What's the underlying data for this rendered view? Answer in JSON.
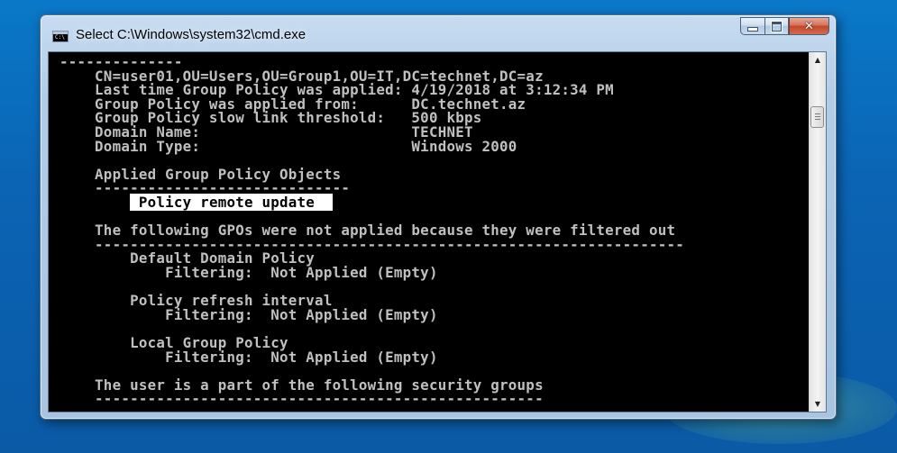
{
  "window": {
    "title": "Select C:\\Windows\\system32\\cmd.exe",
    "icon_label": "C:\\",
    "controls": {
      "minimize": "minimize-icon",
      "maximize": "maximize-icon",
      "close": "✕"
    }
  },
  "console": {
    "lines": [
      {
        "text": "--------------"
      },
      {
        "text": "    CN=user01,OU=Users,OU=Group1,OU=IT,DC=technet,DC=az"
      },
      {
        "text": "    Last time Group Policy was applied: 4/19/2018 at 3:12:34 PM"
      },
      {
        "text": "    Group Policy was applied from:      DC.technet.az"
      },
      {
        "text": "    Group Policy slow link threshold:   500 kbps"
      },
      {
        "text": "    Domain Name:                        TECHNET"
      },
      {
        "text": "    Domain Type:                        Windows 2000"
      },
      {
        "text": ""
      },
      {
        "text": "    Applied Group Policy Objects"
      },
      {
        "text": "    -----------------------------"
      },
      {
        "text": "        ",
        "selected": " Policy remote update  "
      },
      {
        "text": ""
      },
      {
        "text": "    The following GPOs were not applied because they were filtered out"
      },
      {
        "text": "    -------------------------------------------------------------------"
      },
      {
        "text": "        Default Domain Policy"
      },
      {
        "text": "            Filtering:  Not Applied (Empty)"
      },
      {
        "text": ""
      },
      {
        "text": "        Policy refresh interval"
      },
      {
        "text": "            Filtering:  Not Applied (Empty)"
      },
      {
        "text": ""
      },
      {
        "text": "        Local Group Policy"
      },
      {
        "text": "            Filtering:  Not Applied (Empty)"
      },
      {
        "text": ""
      },
      {
        "text": "    The user is a part of the following security groups"
      },
      {
        "text": "    ---------------------------------------------------"
      }
    ]
  },
  "scrollbar": {
    "up_glyph": "▲",
    "down_glyph": "▼"
  },
  "colors": {
    "console_bg": "#000000",
    "console_text": "#c0c0c0",
    "selection_bg": "#ffffff",
    "selection_text": "#000000"
  }
}
